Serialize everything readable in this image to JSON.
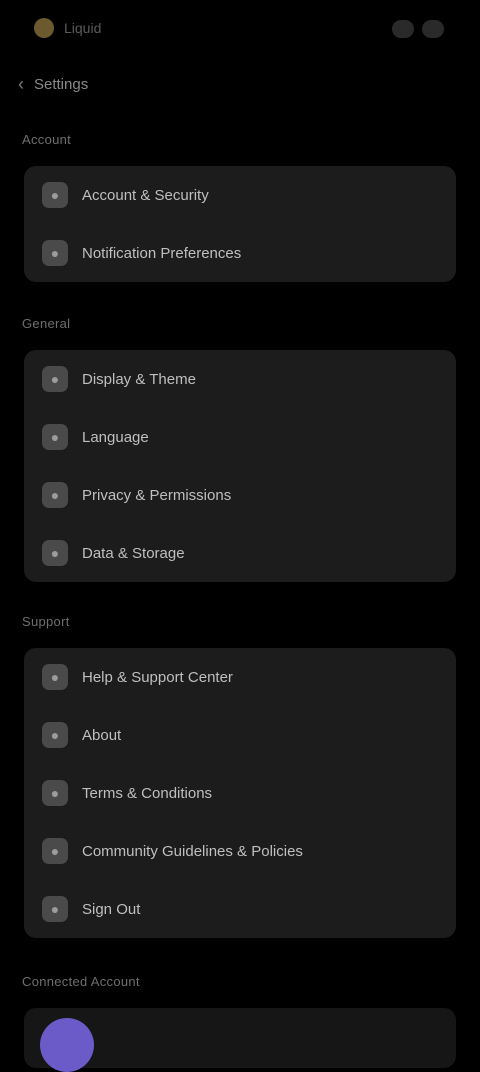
{
  "topbar": {
    "app_name": "Liquid"
  },
  "nav": {
    "back_label": "Settings"
  },
  "sections": [
    {
      "title": "Account",
      "items": [
        {
          "label": "Account & Security",
          "icon": "user-icon"
        },
        {
          "label": "Notification Preferences",
          "icon": "bell-icon"
        }
      ]
    },
    {
      "title": "General",
      "items": [
        {
          "label": "Display & Theme",
          "icon": "palette-icon"
        },
        {
          "label": "Language",
          "icon": "globe-icon"
        },
        {
          "label": "Privacy & Permissions",
          "icon": "lock-icon"
        },
        {
          "label": "Data & Storage",
          "icon": "database-icon"
        }
      ]
    },
    {
      "title": "Support",
      "items": [
        {
          "label": "Help & Support Center",
          "icon": "help-icon"
        },
        {
          "label": "About",
          "icon": "info-icon"
        },
        {
          "label": "Terms & Conditions",
          "icon": "document-icon"
        },
        {
          "label": "Community Guidelines & Policies",
          "icon": "shield-icon"
        },
        {
          "label": "Sign Out",
          "icon": "logout-icon"
        }
      ]
    }
  ],
  "footer": {
    "section_title": "Connected Account"
  },
  "colors": {
    "accent": "#6a5bc9",
    "surface": "#1c1c1c",
    "background": "#000000"
  }
}
